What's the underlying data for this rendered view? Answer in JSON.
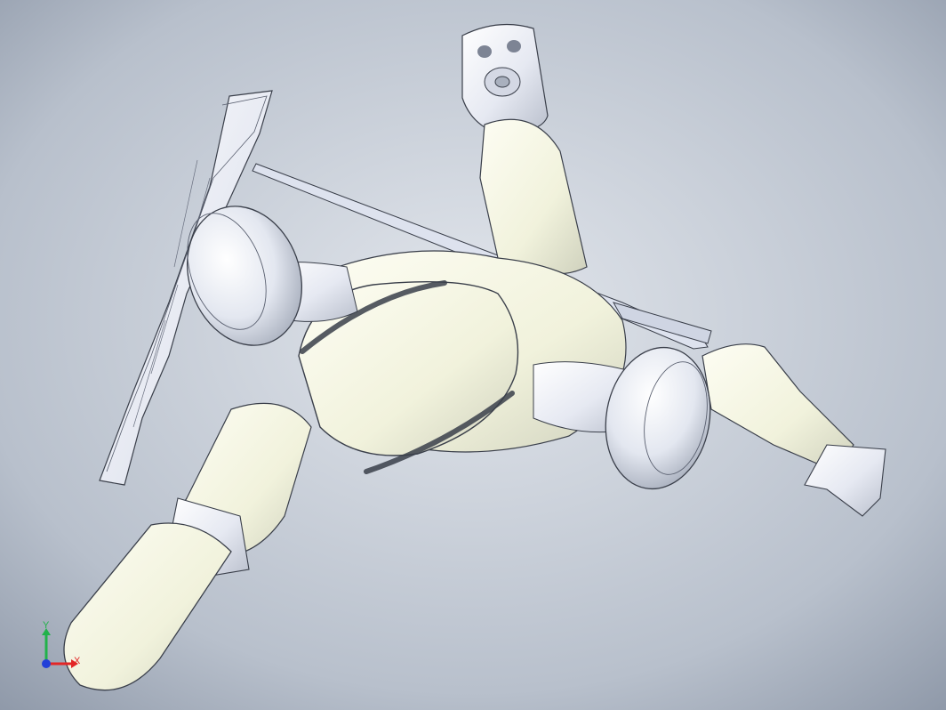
{
  "viewport": {
    "background_top": "#8e98a8",
    "background_center": "#e2e6ec",
    "background_bottom": "#aab2bf"
  },
  "model": {
    "body_color": "#f4f5e2",
    "shell_color": "#e8ebf4",
    "edge_color": "#3a3f4a",
    "shadow_color": "#c9cbb8"
  },
  "triad": {
    "x_label": "X",
    "y_label": "Y",
    "x_color": "#e32626",
    "y_color": "#22b24a",
    "z_color": "#2340d8"
  }
}
